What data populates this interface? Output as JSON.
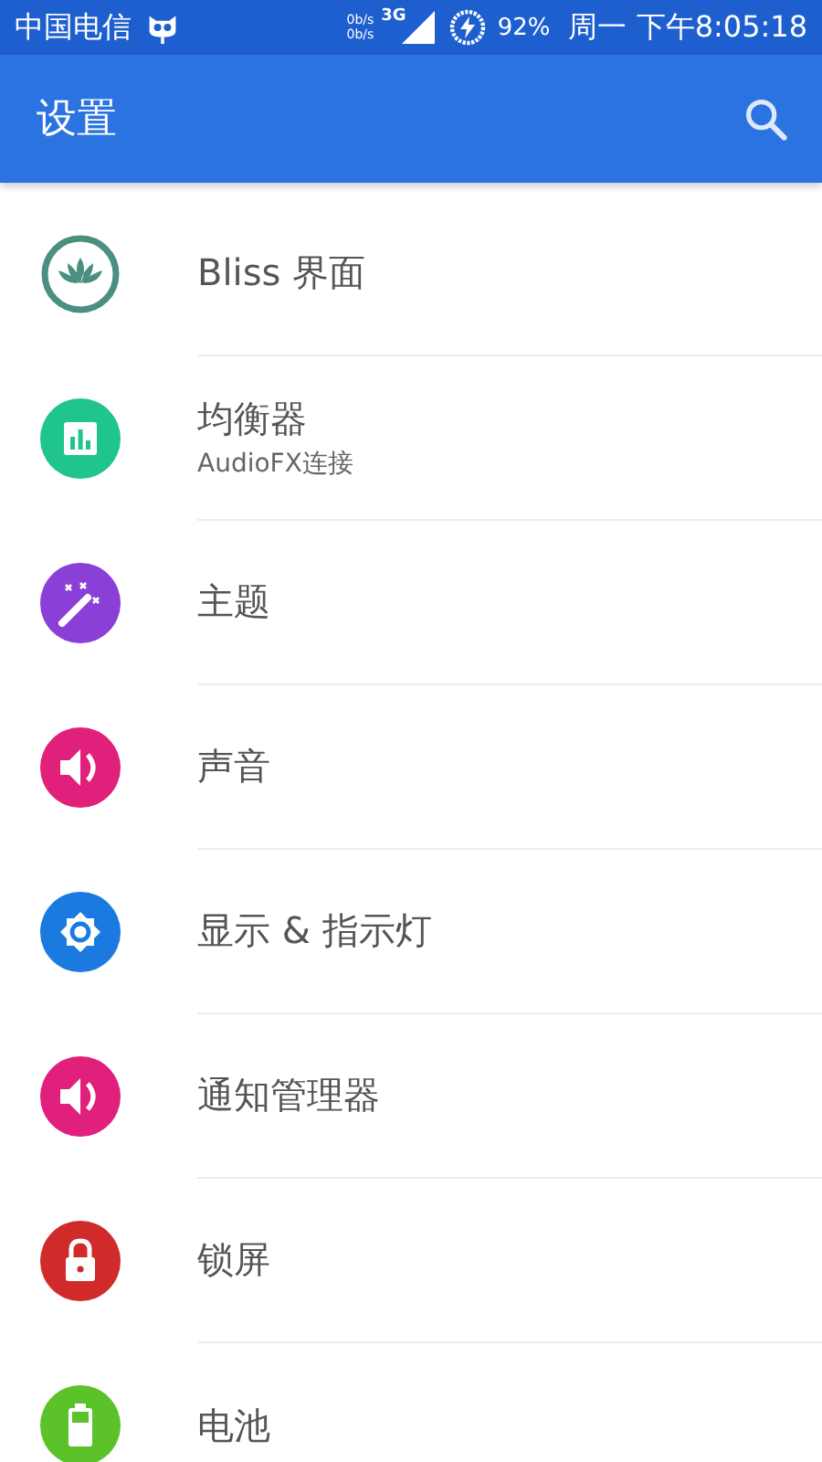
{
  "status_bar": {
    "carrier": "中国电信",
    "up_rate": "0b/s",
    "down_rate": "0b/s",
    "network": "3G",
    "battery": "92%",
    "time": "周一 下午8:05:18"
  },
  "app_bar": {
    "title": "设置"
  },
  "items": [
    {
      "title": "Bliss 界面",
      "kind": "lotus",
      "color": "#4a8f7f"
    },
    {
      "title": "均衡器",
      "subtitle": "AudioFX连接",
      "kind": "equalizer",
      "color": "#1fc58a"
    },
    {
      "title": "主题",
      "kind": "wand",
      "color": "#8a3fd6"
    },
    {
      "title": "声音",
      "kind": "speaker",
      "color": "#e0207a"
    },
    {
      "title": "显示 & 指示灯",
      "kind": "brightness",
      "color": "#1a7ae0"
    },
    {
      "title": "通知管理器",
      "kind": "speaker",
      "color": "#e0207a"
    },
    {
      "title": "锁屏",
      "kind": "lock",
      "color": "#d12a2a"
    },
    {
      "title": "电池",
      "kind": "battery",
      "color": "#5cc22a"
    }
  ]
}
